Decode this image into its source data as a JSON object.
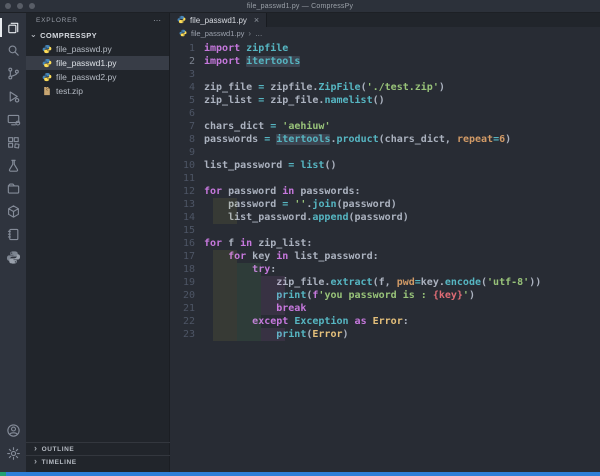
{
  "window": {
    "title": "file_passwd1.py — CompressPy"
  },
  "colors": {
    "statusbar": "#2e7fd8",
    "remote_chip": "#24a172",
    "accent_selection": "#383d47",
    "keyword": "#c678dd",
    "function": "#56b6c2",
    "string": "#98c379",
    "argument": "#d19a66",
    "default_text": "#abb2bf",
    "editor_bg": "#282c34"
  },
  "activity_bar": {
    "items": [
      {
        "name": "explorer",
        "active": true
      },
      {
        "name": "search",
        "active": false
      },
      {
        "name": "source-control",
        "active": false
      },
      {
        "name": "run-debug",
        "active": false
      },
      {
        "name": "remote-explorer",
        "active": false
      },
      {
        "name": "extensions",
        "active": false
      },
      {
        "name": "testing",
        "active": false
      },
      {
        "name": "project-manager",
        "active": false
      },
      {
        "name": "package",
        "active": false
      },
      {
        "name": "notebook",
        "active": false
      },
      {
        "name": "python-extension",
        "active": false
      }
    ],
    "bottom_items": [
      {
        "name": "account",
        "active": false
      },
      {
        "name": "settings",
        "active": false
      }
    ]
  },
  "sidebar": {
    "header": "EXPLORER",
    "actions_label": "⋯",
    "section": "COMPRESSPY",
    "files": [
      {
        "label": "file_passwd.py",
        "icon": "python",
        "selected": false
      },
      {
        "label": "file_passwd1.py",
        "icon": "python",
        "selected": true
      },
      {
        "label": "file_passwd2.py",
        "icon": "python",
        "selected": false
      },
      {
        "label": "test.zip",
        "icon": "zip",
        "selected": false
      }
    ],
    "panels": [
      {
        "label": "OUTLINE"
      },
      {
        "label": "TIMELINE"
      }
    ]
  },
  "editor": {
    "tab": {
      "label": "file_passwd1.py",
      "close": "×"
    },
    "breadcrumb": {
      "file": "file_passwd1.py",
      "sep": "›",
      "more": "…"
    },
    "code": {
      "active_line": 2,
      "lines": [
        {
          "n": 1,
          "tokens": [
            [
              "kw",
              "import"
            ],
            [
              "pl",
              " "
            ],
            [
              "fn",
              "zipfile"
            ]
          ]
        },
        {
          "n": 2,
          "tokens": [
            [
              "kw",
              "import"
            ],
            [
              "pl",
              " "
            ],
            [
              "fn hl",
              "itertools"
            ]
          ]
        },
        {
          "n": 3,
          "tokens": []
        },
        {
          "n": 4,
          "tokens": [
            [
              "pl",
              "zip_file "
            ],
            [
              "op",
              "="
            ],
            [
              "pl",
              " zipfile."
            ],
            [
              "fn",
              "ZipFile"
            ],
            [
              "pl",
              "("
            ],
            [
              "str",
              "'./test.zip'"
            ],
            [
              "pl",
              ")"
            ]
          ]
        },
        {
          "n": 5,
          "tokens": [
            [
              "pl",
              "zip_list "
            ],
            [
              "op",
              "="
            ],
            [
              "pl",
              " zip_file."
            ],
            [
              "fn",
              "namelist"
            ],
            [
              "pl",
              "()"
            ]
          ]
        },
        {
          "n": 6,
          "tokens": []
        },
        {
          "n": 7,
          "tokens": [
            [
              "pl",
              "chars_dict "
            ],
            [
              "op",
              "="
            ],
            [
              "pl",
              " "
            ],
            [
              "str",
              "'aehiuw'"
            ]
          ]
        },
        {
          "n": 8,
          "tokens": [
            [
              "pl",
              "passwords "
            ],
            [
              "op",
              "="
            ],
            [
              "pl",
              " "
            ],
            [
              "fn hl",
              "itertools"
            ],
            [
              "pl",
              "."
            ],
            [
              "fn",
              "product"
            ],
            [
              "pl",
              "(chars_dict, "
            ],
            [
              "arg",
              "repeat"
            ],
            [
              "op",
              "="
            ],
            [
              "num",
              "6"
            ],
            [
              "pl",
              ")"
            ]
          ]
        },
        {
          "n": 9,
          "tokens": []
        },
        {
          "n": 10,
          "tokens": [
            [
              "pl",
              "list_password "
            ],
            [
              "op",
              "="
            ],
            [
              "pl",
              " "
            ],
            [
              "fn",
              "list"
            ],
            [
              "pl",
              "()"
            ]
          ]
        },
        {
          "n": 11,
          "tokens": []
        },
        {
          "n": 12,
          "tokens": [
            [
              "kw",
              "for"
            ],
            [
              "pl",
              " password "
            ],
            [
              "kw",
              "in"
            ],
            [
              "pl",
              " passwords:"
            ]
          ]
        },
        {
          "n": 13,
          "tokens": [
            [
              "ws",
              "    "
            ],
            [
              "pl",
              "password "
            ],
            [
              "op",
              "="
            ],
            [
              "pl",
              " "
            ],
            [
              "str",
              "''"
            ],
            [
              "pl",
              "."
            ],
            [
              "fn",
              "join"
            ],
            [
              "pl",
              "(password)"
            ]
          ]
        },
        {
          "n": 14,
          "tokens": [
            [
              "ws",
              "    "
            ],
            [
              "pl",
              "list_password."
            ],
            [
              "fn",
              "append"
            ],
            [
              "pl",
              "(password)"
            ]
          ]
        },
        {
          "n": 15,
          "tokens": []
        },
        {
          "n": 16,
          "tokens": [
            [
              "kw",
              "for"
            ],
            [
              "pl",
              " f "
            ],
            [
              "kw",
              "in"
            ],
            [
              "pl",
              " zip_list:"
            ]
          ]
        },
        {
          "n": 17,
          "tokens": [
            [
              "ws",
              "    "
            ],
            [
              "kw",
              "for"
            ],
            [
              "pl",
              " key "
            ],
            [
              "kw",
              "in"
            ],
            [
              "pl",
              " list_password:"
            ]
          ]
        },
        {
          "n": 18,
          "tokens": [
            [
              "ws",
              "        "
            ],
            [
              "kw",
              "try"
            ],
            [
              "pl",
              ":"
            ]
          ]
        },
        {
          "n": 19,
          "tokens": [
            [
              "ws",
              "            "
            ],
            [
              "pl",
              "zip_file."
            ],
            [
              "fn",
              "extract"
            ],
            [
              "pl",
              "(f, "
            ],
            [
              "arg",
              "pwd"
            ],
            [
              "op",
              "="
            ],
            [
              "pl",
              "key."
            ],
            [
              "fn",
              "encode"
            ],
            [
              "pl",
              "("
            ],
            [
              "str",
              "'utf-8'"
            ],
            [
              "pl",
              "))"
            ]
          ]
        },
        {
          "n": 20,
          "tokens": [
            [
              "ws",
              "            "
            ],
            [
              "fn",
              "print"
            ],
            [
              "pl",
              "("
            ],
            [
              "fstr",
              "f"
            ],
            [
              "str",
              "'you password is : "
            ],
            [
              "brace",
              "{key}"
            ],
            [
              "str",
              "'"
            ],
            [
              "pl",
              ")"
            ]
          ]
        },
        {
          "n": 21,
          "tokens": [
            [
              "ws",
              "            "
            ],
            [
              "kw",
              "break"
            ]
          ]
        },
        {
          "n": 22,
          "tokens": [
            [
              "ws",
              "        "
            ],
            [
              "kw",
              "except"
            ],
            [
              "pl",
              " "
            ],
            [
              "fn",
              "Exception"
            ],
            [
              "pl",
              " "
            ],
            [
              "kw",
              "as"
            ],
            [
              "pl",
              " "
            ],
            [
              "cls",
              "Error"
            ],
            [
              "pl",
              ":"
            ]
          ]
        },
        {
          "n": 23,
          "tokens": [
            [
              "ws",
              "            "
            ],
            [
              "fn",
              "print"
            ],
            [
              "pl",
              "("
            ],
            [
              "cls",
              "Error"
            ],
            [
              "pl",
              ")"
            ]
          ]
        }
      ]
    }
  }
}
